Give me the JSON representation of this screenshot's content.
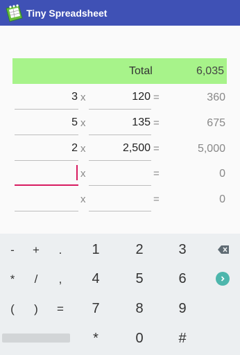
{
  "app": {
    "title": "Tiny Spreadsheet"
  },
  "summary": {
    "total_label": "Total",
    "total_value": "6,035"
  },
  "operators": {
    "times": "x",
    "equals": "="
  },
  "rows": [
    {
      "qty": "3",
      "price": "120",
      "result": "360"
    },
    {
      "qty": "5",
      "price": "135",
      "result": "675"
    },
    {
      "qty": "2",
      "price": "2,500",
      "result": "5,000"
    },
    {
      "qty": "",
      "price": "",
      "result": "0"
    },
    {
      "qty": "",
      "price": "",
      "result": "0"
    }
  ],
  "keyboard": {
    "row1": [
      "-",
      "+",
      ".",
      "1",
      "2",
      "3"
    ],
    "row2": [
      "*",
      "/",
      ",",
      "4",
      "5",
      "6"
    ],
    "row3": [
      "(",
      ")",
      "=",
      "7",
      "8",
      "9"
    ],
    "row4": [
      "*",
      "0",
      "#"
    ],
    "icons": {
      "backspace": "backspace-icon",
      "next": "next-arrow-icon"
    },
    "accent": "#4db6ac"
  },
  "colors": {
    "appbar": "#3f51b5",
    "total_bg": "#a7f38a",
    "active_field": "#d81b60"
  }
}
